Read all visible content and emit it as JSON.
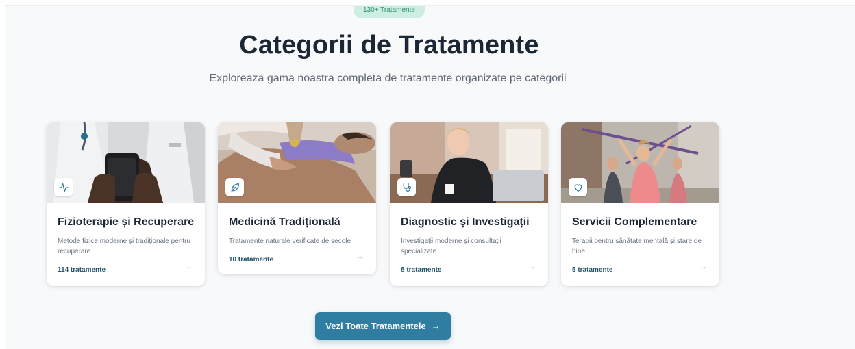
{
  "section": {
    "badge": "130+ Tratamente",
    "title": "Categorii de Tratamente",
    "subtitle": "Exploreaza gama noastra completa de tratamente organizate pe categorii"
  },
  "categories": [
    {
      "title": "Fizioterapie și Recuperare",
      "description": "Metode fizice moderne și tradiționale pentru recuperare",
      "count": "114 tratamente",
      "icon": "activity-icon",
      "arrow": "→"
    },
    {
      "title": "Medicină Tradițională",
      "description": "Tratamente naturale verificate de secole",
      "count": "10 tratamente",
      "icon": "leaf-icon",
      "arrow": "→"
    },
    {
      "title": "Diagnostic și Investigații",
      "description": "Investigații moderne și consultații specializate",
      "count": "8 tratamente",
      "icon": "stethoscope-icon",
      "arrow": "→"
    },
    {
      "title": "Servicii Complementare",
      "description": "Terapii pentru sănătate mentală și stare de bine",
      "count": "5 tratamente",
      "icon": "heart-icon",
      "arrow": "→"
    }
  ],
  "cta": {
    "label": "Vezi Toate Tratamentele",
    "arrow": "→"
  },
  "colors": {
    "accent": "#2f7da1",
    "badge_bg": "#cdeee3",
    "heading": "#1c2736"
  }
}
